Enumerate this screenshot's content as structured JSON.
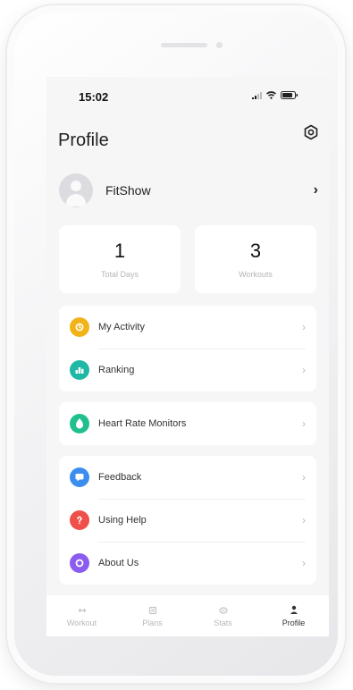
{
  "status_bar": {
    "time": "15:02"
  },
  "header": {
    "title": "Profile",
    "settings_icon": "gear-icon"
  },
  "user": {
    "name": "FitShow",
    "avatar_icon": "user-icon"
  },
  "stats": [
    {
      "value": "1",
      "label": "Total Days"
    },
    {
      "value": "3",
      "label": "Workouts"
    }
  ],
  "menu_groups": [
    [
      {
        "label": "My Activity",
        "icon": "activity-icon",
        "color": "#f2b319"
      },
      {
        "label": "Ranking",
        "icon": "ranking-icon",
        "color": "#1fb8a5"
      }
    ],
    [
      {
        "label": "Heart Rate Monitors",
        "icon": "heart-rate-icon",
        "color": "#20c08e"
      }
    ],
    [
      {
        "label": "Feedback",
        "icon": "feedback-icon",
        "color": "#3b8ef0"
      },
      {
        "label": "Using Help",
        "icon": "help-icon",
        "color": "#f0504a"
      },
      {
        "label": "About Us",
        "icon": "about-icon",
        "color": "#8a5cf0"
      }
    ]
  ],
  "tabs": [
    {
      "label": "Workout",
      "icon": "workout-icon",
      "active": false
    },
    {
      "label": "Plans",
      "icon": "plans-icon",
      "active": false
    },
    {
      "label": "Stats",
      "icon": "stats-icon",
      "active": false
    },
    {
      "label": "Profile",
      "icon": "profile-icon",
      "active": true
    }
  ],
  "colors": {
    "background": "#f6f6f7",
    "card": "#ffffff",
    "text": "#222222",
    "muted": "#b8b8bb"
  }
}
